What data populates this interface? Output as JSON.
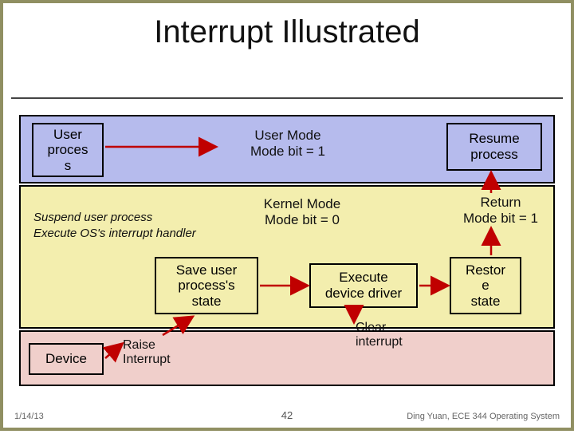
{
  "title": "Interrupt Illustrated",
  "zones": {
    "user": {
      "heading_line1": "User Mode",
      "heading_line2": "Mode bit = 1"
    },
    "kernel": {
      "heading_line1": "Kernel Mode",
      "heading_line2": "Mode bit = 0",
      "return_line1": "Return",
      "return_line2": "Mode bit = 1"
    },
    "device": {}
  },
  "boxes": {
    "user_process": "User\nproces\ns",
    "resume_process": "Resume\nprocess",
    "save_state": "Save user\nprocess's\nstate",
    "exec_driver": "Execute\ndevice driver",
    "restore_state": "Restor\ne\nstate",
    "device": "Device"
  },
  "italic_notes": {
    "suspend": "Suspend user process",
    "execute_handler": "Execute OS's interrupt handler"
  },
  "small_labels": {
    "raise_interrupt": "Raise\nInterrupt",
    "clear_interrupt": "Clear\ninterrupt"
  },
  "footer": {
    "date": "1/14/13",
    "page": "42",
    "source": "Ding Yuan, ECE 344 Operating System"
  },
  "colors": {
    "user_zone": "#b6bbed",
    "kernel_zone": "#f3eeae",
    "device_zone": "#f0cfcb",
    "arrow": "#c00000"
  }
}
